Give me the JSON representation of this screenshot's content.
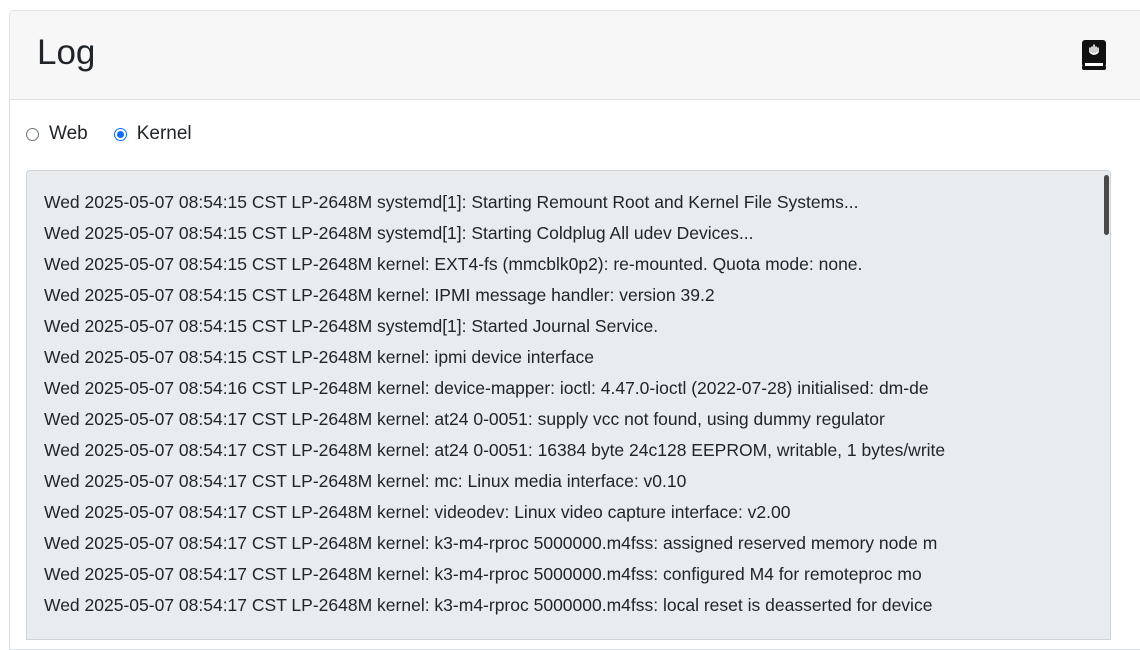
{
  "card": {
    "title": "Log",
    "help_icon": "book-icon"
  },
  "log_type": {
    "options": [
      {
        "label": "Web",
        "checked": false
      },
      {
        "label": "Kernel",
        "checked": true
      }
    ]
  },
  "log": {
    "lines": [
      "Wed 2025-05-07 08:54:15 CST LP-2648M systemd[1]: Starting Remount Root and Kernel File Systems...",
      "Wed 2025-05-07 08:54:15 CST LP-2648M systemd[1]: Starting Coldplug All udev Devices...",
      "Wed 2025-05-07 08:54:15 CST LP-2648M kernel: EXT4-fs (mmcblk0p2): re-mounted. Quota mode: none.",
      "Wed 2025-05-07 08:54:15 CST LP-2648M kernel: IPMI message handler: version 39.2",
      "Wed 2025-05-07 08:54:15 CST LP-2648M systemd[1]: Started Journal Service.",
      "Wed 2025-05-07 08:54:15 CST LP-2648M kernel: ipmi device interface",
      "Wed 2025-05-07 08:54:16 CST LP-2648M kernel: device-mapper: ioctl: 4.47.0-ioctl (2022-07-28) initialised: dm-de",
      "Wed 2025-05-07 08:54:17 CST LP-2648M kernel: at24 0-0051: supply vcc not found, using dummy regulator",
      "Wed 2025-05-07 08:54:17 CST LP-2648M kernel: at24 0-0051: 16384 byte 24c128 EEPROM, writable, 1 bytes/write",
      "Wed 2025-05-07 08:54:17 CST LP-2648M kernel: mc: Linux media interface: v0.10",
      "Wed 2025-05-07 08:54:17 CST LP-2648M kernel: videodev: Linux video capture interface: v2.00",
      "Wed 2025-05-07 08:54:17 CST LP-2648M kernel: k3-m4-rproc 5000000.m4fss: assigned reserved memory node m",
      "Wed 2025-05-07 08:54:17 CST LP-2648M kernel: k3-m4-rproc 5000000.m4fss: configured M4 for remoteproc mo",
      "Wed 2025-05-07 08:54:17 CST LP-2648M kernel: k3-m4-rproc 5000000.m4fss: local reset is deasserted for device"
    ]
  }
}
